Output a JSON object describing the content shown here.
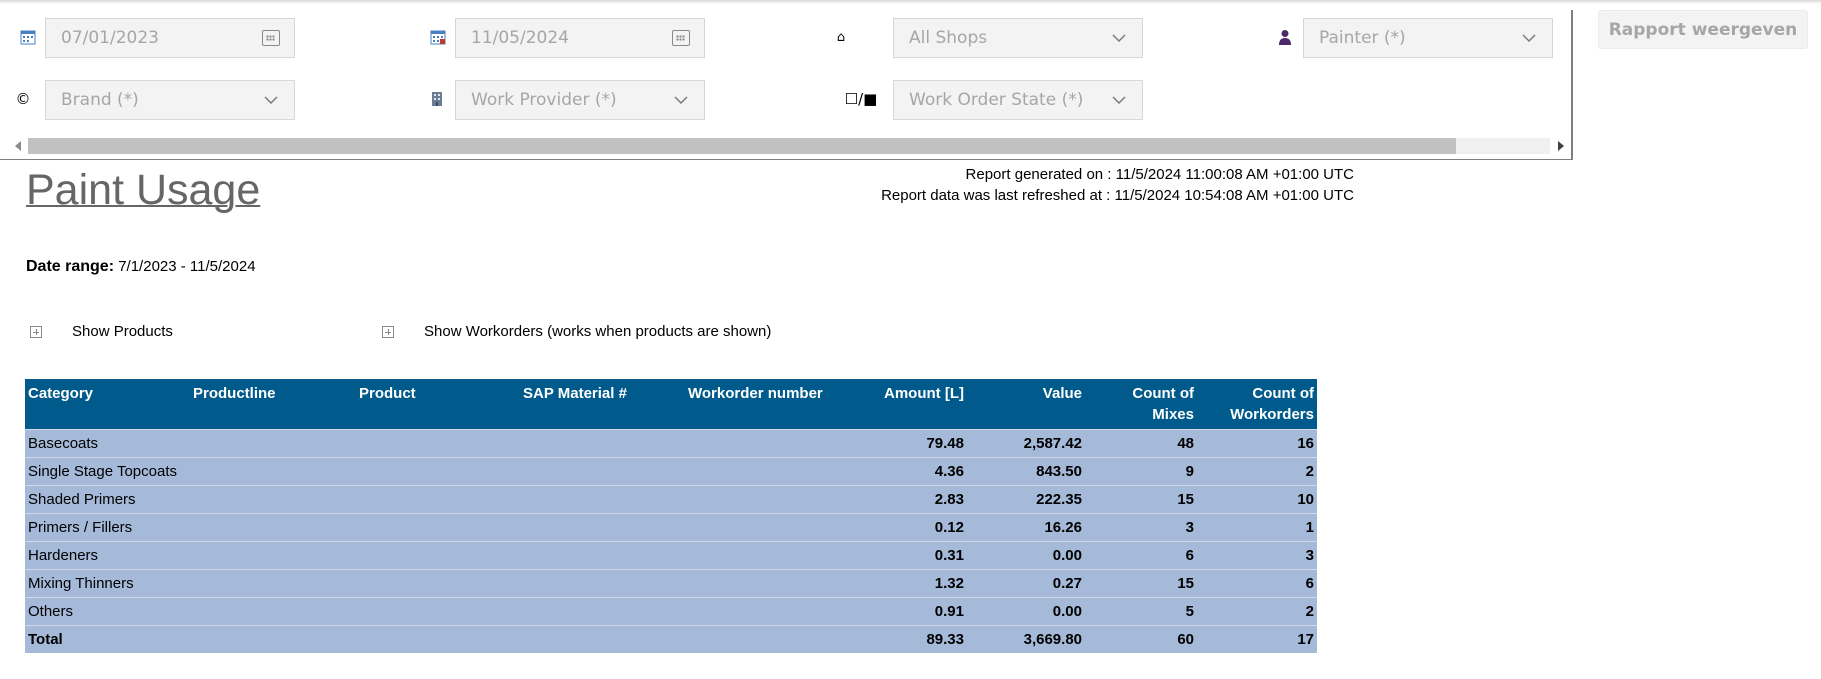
{
  "params": {
    "start_date": "07/01/2023",
    "end_date": "11/05/2024",
    "shops": "All Shops",
    "painter": "Painter (*)",
    "brand": "Brand (*)",
    "work_provider": "Work Provider (*)",
    "work_order_state": "Work Order State (*)",
    "brand_icon_glyph": "©",
    "shop_icon_glyph": "⌂",
    "state_icon_glyph": "☐/■",
    "run_button": "Rapport weergeven"
  },
  "report": {
    "title": "Paint Usage",
    "generated": "Report generated on : 11/5/2024 11:00:08 AM +01:00 UTC",
    "refreshed": "Report data was last refreshed at : 11/5/2024 10:54:08 AM +01:00 UTC",
    "date_range_label": "Date range:",
    "date_range_value": "7/1/2023 - 11/5/2024",
    "show_products": "Show Products",
    "show_workorders": "Show Workorders (works when products are shown)"
  },
  "table": {
    "columns": [
      "Category",
      "Productline",
      "Product",
      "SAP Material #",
      "Workorder number",
      "Amount [L]",
      "Value",
      "Count of Mixes",
      "Count of Workorders"
    ],
    "rows": [
      {
        "category": "Basecoats",
        "amount": "79.48",
        "value": "2,587.42",
        "mixes": "48",
        "workorders": "16"
      },
      {
        "category": "Single Stage Topcoats",
        "amount": "4.36",
        "value": "843.50",
        "mixes": "9",
        "workorders": "2"
      },
      {
        "category": "Shaded Primers",
        "amount": "2.83",
        "value": "222.35",
        "mixes": "15",
        "workorders": "10"
      },
      {
        "category": "Primers / Fillers",
        "amount": "0.12",
        "value": "16.26",
        "mixes": "3",
        "workorders": "1"
      },
      {
        "category": "Hardeners",
        "amount": "0.31",
        "value": "0.00",
        "mixes": "6",
        "workorders": "3"
      },
      {
        "category": "Mixing Thinners",
        "amount": "1.32",
        "value": "0.27",
        "mixes": "15",
        "workorders": "6"
      },
      {
        "category": "Others",
        "amount": "0.91",
        "value": "0.00",
        "mixes": "5",
        "workorders": "2"
      }
    ],
    "total": {
      "category": "Total",
      "amount": "89.33",
      "value": "3,669.80",
      "mixes": "60",
      "workorders": "17"
    }
  },
  "colors": {
    "header_bg": "#005a8c",
    "row_bg": "#a5b9d9",
    "title": "#666666"
  }
}
